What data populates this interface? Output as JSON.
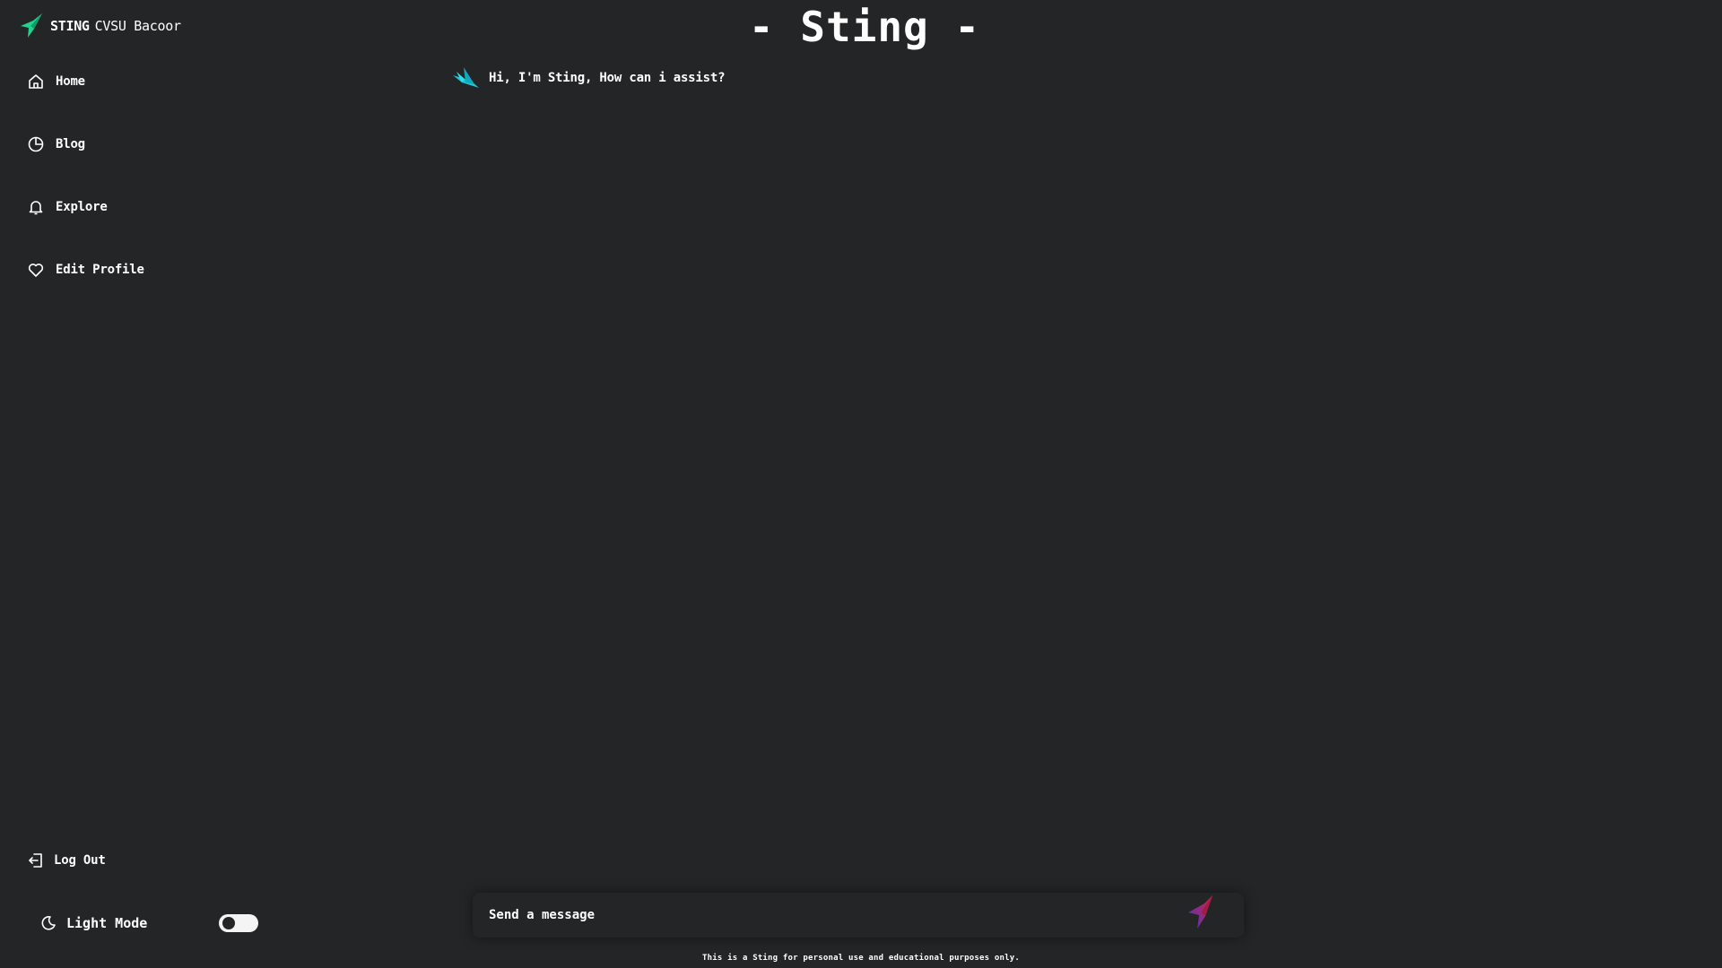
{
  "brand": {
    "name": "STING",
    "subtitle": "CVSU Bacoor",
    "logo_icon": "sting-bird-logo"
  },
  "header": {
    "title": "- Sting -"
  },
  "sidebar": {
    "items": [
      {
        "label": "Home",
        "icon": "home-icon"
      },
      {
        "label": "Blog",
        "icon": "pie-chart-icon"
      },
      {
        "label": "Explore",
        "icon": "bell-icon"
      },
      {
        "label": "Edit Profile",
        "icon": "heart-icon"
      }
    ],
    "logout": {
      "label": "Log Out",
      "icon": "logout-icon"
    },
    "mode": {
      "label": "Light Mode",
      "icon": "moon-icon",
      "toggle_on": false
    }
  },
  "chat": {
    "messages": [
      {
        "sender": "bot",
        "text": "Hi, I'm Sting, How can i assist?"
      }
    ]
  },
  "composer": {
    "placeholder": "Send a message",
    "value": ""
  },
  "footer": {
    "disclaimer": "This is a Sting for personal use and educational purposes only."
  },
  "colors": {
    "background": "#242527",
    "text": "#ffffff",
    "logo_green": "#1fd58d",
    "logo_cyan": "#19c7d8",
    "send_red": "#d8203b",
    "send_purple": "#4a35c9"
  }
}
